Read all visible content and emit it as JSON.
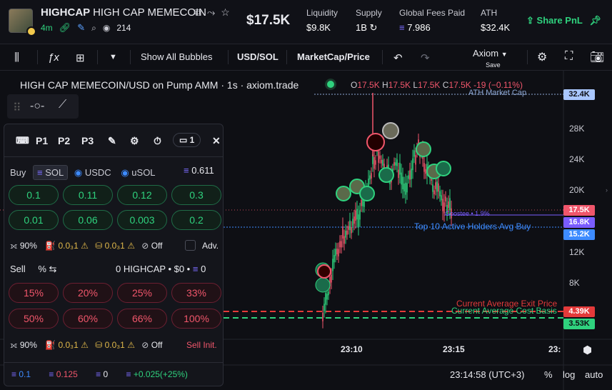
{
  "header": {
    "token_name": "HIGHCAP",
    "token_full": "HIGH CAP MEMECOIN",
    "age": "4m",
    "watchers": "214",
    "price": "$17.5K",
    "stats": [
      {
        "label": "Liquidity",
        "value": "$9.8K"
      },
      {
        "label": "Supply",
        "value": "1B"
      },
      {
        "label": "Global Fees Paid",
        "value": "7.986"
      },
      {
        "label": "ATH",
        "value": "$32.4K"
      }
    ],
    "share_label": "Share PnL"
  },
  "toolbar": {
    "show_bubbles": "Show All Bubbles",
    "currency": "USD/SOL",
    "mode": "MarketCap/Price",
    "axiom": "Axiom",
    "axiom_save": "Save"
  },
  "chart": {
    "title": "HIGH CAP MEMECOIN/USD on Pump AMM · 1s · axiom.trade",
    "ohlc": {
      "o": "17.5K",
      "h": "17.5K",
      "l": "17.5K",
      "c": "17.5K",
      "chg": "-19 (−0.11%)"
    },
    "y_ticks": [
      "28K",
      "24K",
      "20K",
      "12K",
      "8K"
    ],
    "badges": [
      {
        "text": "32.4K",
        "color": "#a9c7ff",
        "fg": "#0e0f14"
      },
      {
        "text": "17.5K",
        "color": "#f0566b",
        "fg": "#ffffff"
      },
      {
        "text": "16.8K",
        "color": "#7a5cff",
        "fg": "#ffffff"
      },
      {
        "text": "15.2K",
        "color": "#3d8bff",
        "fg": "#ffffff"
      },
      {
        "text": "4.39K",
        "color": "#e33a3a",
        "fg": "#ffffff"
      },
      {
        "text": "3.53K",
        "color": "#2fd27e",
        "fg": "#0e0f14"
      }
    ],
    "ath_label": "ATH Market Cap",
    "holders_label": "Top 10 Active Holders Avg Buy",
    "dev_label": "Goostee • 1.9%",
    "exit_label": "Current Average Exit Price",
    "cost_label": "Current Average Cost Basis",
    "time_ticks": [
      "23:10",
      "23:15",
      "23:"
    ],
    "clock": "23:14:58 (UTC+3)",
    "scale_opts": [
      "%",
      "log",
      "auto"
    ]
  },
  "panel": {
    "presets": [
      "P1",
      "P2",
      "P3"
    ],
    "wallets": "1",
    "buy_label": "Buy",
    "buy_tokens": [
      "SOL",
      "USDC",
      "uSOL"
    ],
    "buy_balance": "0.611",
    "buy_amounts": [
      "0.1",
      "0.11",
      "0.12",
      "0.3",
      "0.01",
      "0.06",
      "0.003",
      "0.2"
    ],
    "slippage": "90%",
    "priority": "0.0₃1",
    "bribe": "0.0₃1",
    "mev": "Off",
    "adv": "Adv.",
    "sell_label": "Sell",
    "sell_pct": "%",
    "sell_summary": "0 HIGHCAP • $0 •",
    "sell_sol": "0",
    "sell_amounts": [
      "15%",
      "20%",
      "25%",
      "33%",
      "50%",
      "60%",
      "66%",
      "100%"
    ],
    "sell_init": "Sell Init.",
    "footer": [
      "0.1",
      "0.125",
      "0",
      "+0.025(+25%)"
    ]
  }
}
